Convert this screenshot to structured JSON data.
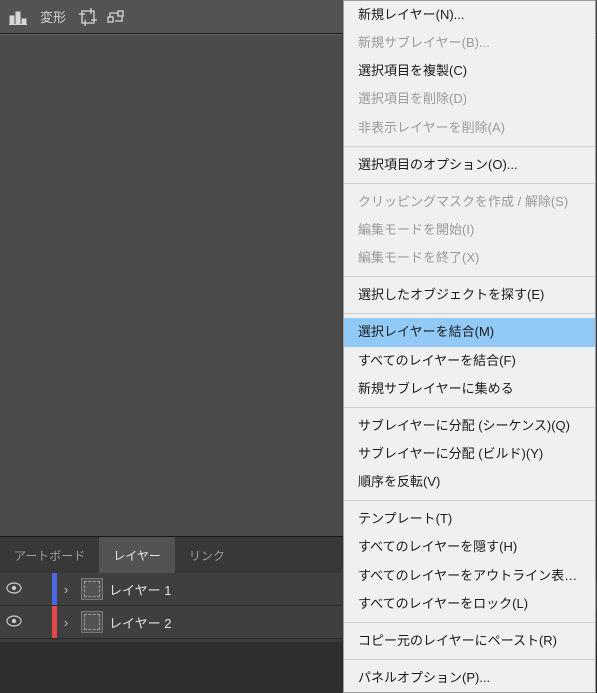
{
  "toolbar": {
    "transform_label": "変形"
  },
  "tabs": {
    "artboard": "アートボード",
    "layers": "レイヤー",
    "links": "リンク",
    "expand_glyph": ">>"
  },
  "layers": [
    {
      "name": "レイヤー 1",
      "color": "blue"
    },
    {
      "name": "レイヤー 2",
      "color": "red"
    }
  ],
  "side_panel": {
    "artboard": "アートボード",
    "layers": "レイヤー",
    "links": "リンク"
  },
  "context_menu": {
    "groups": [
      [
        {
          "label": "新規レイヤー(N)...",
          "state": "enabled"
        },
        {
          "label": "新規サブレイヤー(B)...",
          "state": "disabled"
        },
        {
          "label": "選択項目を複製(C)",
          "state": "enabled"
        },
        {
          "label": "選択項目を削除(D)",
          "state": "disabled"
        },
        {
          "label": "非表示レイヤーを削除(A)",
          "state": "disabled"
        }
      ],
      [
        {
          "label": "選択項目のオプション(O)...",
          "state": "enabled"
        }
      ],
      [
        {
          "label": "クリッピングマスクを作成 / 解除(S)",
          "state": "disabled"
        },
        {
          "label": "編集モードを開始(I)",
          "state": "disabled"
        },
        {
          "label": "編集モードを終了(X)",
          "state": "disabled"
        }
      ],
      [
        {
          "label": "選択したオブジェクトを探す(E)",
          "state": "enabled"
        }
      ],
      [
        {
          "label": "選択レイヤーを結合(M)",
          "state": "selected"
        },
        {
          "label": "すべてのレイヤーを結合(F)",
          "state": "enabled"
        },
        {
          "label": "新規サブレイヤーに集める",
          "state": "enabled"
        }
      ],
      [
        {
          "label": "サブレイヤーに分配 (シーケンス)(Q)",
          "state": "enabled"
        },
        {
          "label": "サブレイヤーに分配 (ビルド)(Y)",
          "state": "enabled"
        },
        {
          "label": "順序を反転(V)",
          "state": "enabled"
        }
      ],
      [
        {
          "label": "テンプレート(T)",
          "state": "enabled"
        },
        {
          "label": "すべてのレイヤーを隠す(H)",
          "state": "enabled"
        },
        {
          "label": "すべてのレイヤーをアウトライン表示(U)",
          "state": "enabled"
        },
        {
          "label": "すべてのレイヤーをロック(L)",
          "state": "enabled"
        }
      ],
      [
        {
          "label": "コピー元のレイヤーにペースト(R)",
          "state": "enabled"
        }
      ],
      [
        {
          "label": "パネルオプション(P)...",
          "state": "enabled"
        }
      ]
    ]
  }
}
